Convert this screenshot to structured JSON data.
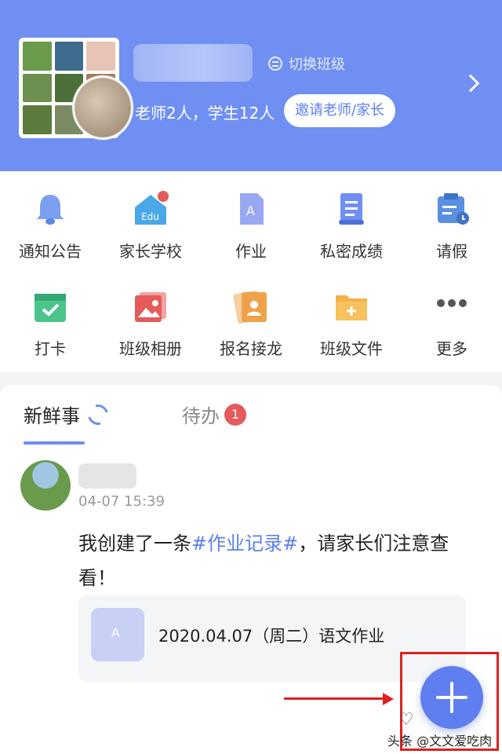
{
  "header": {
    "switch_label": "切换班级",
    "members": "老师2人，学生12人",
    "invite_label": "邀请老师/家长"
  },
  "grid": {
    "items": [
      {
        "label": "通知公告",
        "icon": "bell-icon"
      },
      {
        "label": "家长学校",
        "icon": "edu-house-icon",
        "icon_text": "Edu"
      },
      {
        "label": "作业",
        "icon": "homework-icon",
        "icon_text": "A"
      },
      {
        "label": "私密成绩",
        "icon": "scroll-icon"
      },
      {
        "label": "请假",
        "icon": "leave-icon"
      },
      {
        "label": "打卡",
        "icon": "checkin-icon"
      },
      {
        "label": "班级相册",
        "icon": "album-icon"
      },
      {
        "label": "报名接龙",
        "icon": "signup-icon"
      },
      {
        "label": "班级文件",
        "icon": "folder-icon"
      },
      {
        "label": "更多",
        "icon": "more-icon"
      }
    ]
  },
  "feed": {
    "tab_news": "新鲜事",
    "tab_todo": "待办",
    "todo_badge": "1",
    "post": {
      "time": "04-07 15:39",
      "text_before": "我创建了一条",
      "tag": "#作业记录#",
      "text_after": "，请家长们注意查看！",
      "attachment_name": "2020.04.07（周二）语文作业"
    }
  },
  "watermark": "头条 @文文爱吃肉",
  "colors": {
    "primary": "#6f8ff2",
    "accent": "#5f7ef0",
    "badge": "#e55a5a",
    "annotation": "#e02020"
  }
}
